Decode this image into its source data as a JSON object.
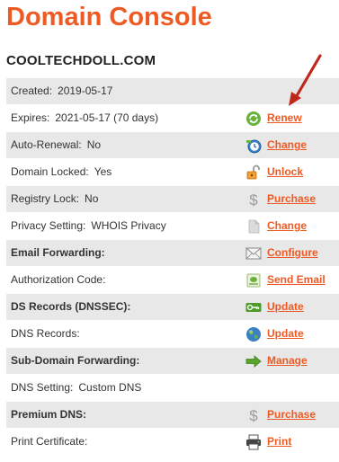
{
  "page_title": "Domain Console",
  "domain_name": "COOLTECHDOLL.COM",
  "colors": {
    "accent": "#ee5a24",
    "row_shade": "#e8e8e8",
    "annotation_arrow": "#c0281c"
  },
  "rows": [
    {
      "label": "Created:",
      "value": "2019-05-17",
      "icon": "",
      "action": ""
    },
    {
      "label": "Expires:",
      "value": "2021-05-17 (70 days)",
      "icon": "refresh-icon",
      "action": "Renew"
    },
    {
      "label": "Auto-Renewal:",
      "value": "No",
      "icon": "clock-icon",
      "action": "Change"
    },
    {
      "label": "Domain Locked:",
      "value": "Yes",
      "icon": "unlock-icon",
      "action": "Unlock"
    },
    {
      "label": "Registry Lock:",
      "value": "No",
      "icon": "dollar-icon",
      "action": "Purchase"
    },
    {
      "label": "Privacy Setting:",
      "value": "WHOIS Privacy",
      "icon": "document-icon",
      "action": "Change"
    },
    {
      "label": "Email Forwarding:",
      "value": "",
      "icon": "envelope-icon",
      "action": "Configure"
    },
    {
      "label": "Authorization Code:",
      "value": "",
      "icon": "send-email-icon",
      "action": "Send Email"
    },
    {
      "label": "DS Records (DNSSEC):",
      "value": "",
      "icon": "key-icon",
      "action": "Update"
    },
    {
      "label": "DNS Records:",
      "value": "",
      "icon": "globe-icon",
      "action": "Update"
    },
    {
      "label": "Sub-Domain Forwarding:",
      "value": "",
      "icon": "arrow-right-icon",
      "action": "Manage"
    },
    {
      "label": "DNS Setting:",
      "value": "Custom DNS",
      "icon": "",
      "action": ""
    },
    {
      "label": "Premium DNS:",
      "value": "",
      "icon": "dollar-icon",
      "action": "Purchase"
    },
    {
      "label": "Print Certificate:",
      "value": "",
      "icon": "printer-icon",
      "action": "Print"
    }
  ]
}
